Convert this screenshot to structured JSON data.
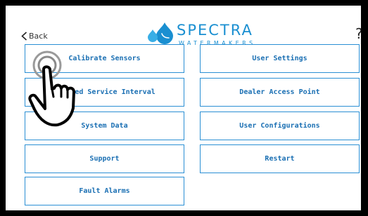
{
  "header": {
    "back_label": "Back",
    "back_icon": "chevron-left-icon",
    "logo_name": "SPECTRA",
    "logo_subtitle": "WATERMAKERS",
    "help_label": "?"
  },
  "menu": {
    "left": [
      {
        "label": "Calibrate Sensors"
      },
      {
        "label": "Updated Service Interval"
      },
      {
        "label": "System Data"
      },
      {
        "label": "Support"
      },
      {
        "label": "Fault Alarms"
      }
    ],
    "right": [
      {
        "label": "User Settings"
      },
      {
        "label": "Dealer Access Point"
      },
      {
        "label": "User Configurations"
      },
      {
        "label": "Restart"
      }
    ]
  },
  "overlay": {
    "icon": "tap-hand-icon"
  },
  "colors": {
    "accent": "#1a8fd1",
    "button_border": "#2a8fd4",
    "button_text": "#1a6fb3",
    "frame": "#000000",
    "background": "#ffffff"
  }
}
